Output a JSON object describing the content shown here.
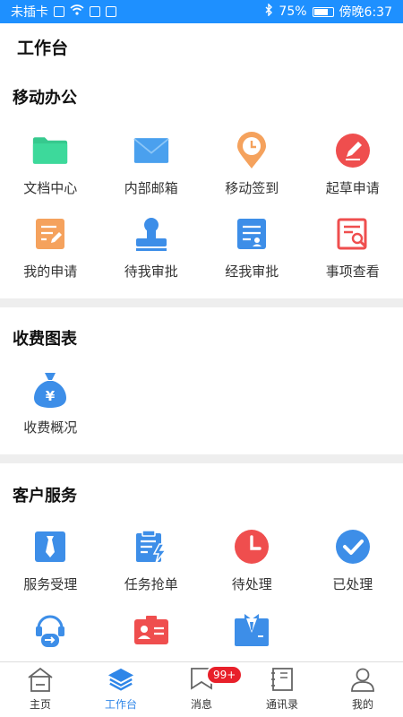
{
  "statusbar": {
    "carrier": "未插卡",
    "battery": "75%",
    "time": "傍晚6:37"
  },
  "header": {
    "title": "工作台"
  },
  "sections": {
    "office": {
      "title": "移动办公",
      "items": [
        {
          "label": "文档中心",
          "icon": "folder-icon"
        },
        {
          "label": "内部邮箱",
          "icon": "mail-icon"
        },
        {
          "label": "移动签到",
          "icon": "location-clock-icon"
        },
        {
          "label": "起草申请",
          "icon": "edit-icon"
        },
        {
          "label": "我的申请",
          "icon": "note-edit-icon"
        },
        {
          "label": "待我审批",
          "icon": "stamp-icon"
        },
        {
          "label": "经我审批",
          "icon": "approved-doc-icon"
        },
        {
          "label": "事项查看",
          "icon": "doc-search-icon"
        }
      ]
    },
    "charts": {
      "title": "收费图表",
      "items": [
        {
          "label": "收费概况",
          "icon": "money-bag-icon"
        }
      ]
    },
    "service": {
      "title": "客户服务",
      "items": [
        {
          "label": "服务受理",
          "icon": "tie-icon"
        },
        {
          "label": "任务抢单",
          "icon": "clipboard-lightning-icon"
        },
        {
          "label": "待处理",
          "icon": "clock-icon"
        },
        {
          "label": "已处理",
          "icon": "check-icon"
        }
      ]
    }
  },
  "tabs": [
    {
      "label": "主页",
      "icon": "home-icon"
    },
    {
      "label": "工作台",
      "icon": "layers-icon"
    },
    {
      "label": "消息",
      "icon": "message-icon",
      "badge": "99+"
    },
    {
      "label": "通讯录",
      "icon": "contacts-icon"
    },
    {
      "label": "我的",
      "icon": "user-icon"
    }
  ]
}
